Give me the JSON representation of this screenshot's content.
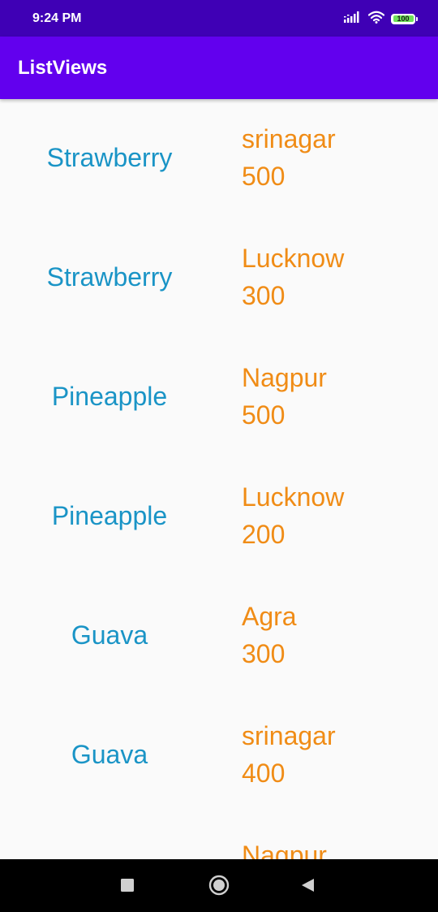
{
  "status_bar": {
    "time": "9:24 PM",
    "battery_level": "100",
    "icons": [
      "signal-icon",
      "wifi-icon",
      "battery-icon"
    ]
  },
  "app_bar": {
    "title": "ListViews",
    "color": "#6200ee"
  },
  "list": {
    "name_color": "#1a94c6",
    "detail_color": "#f08c16",
    "items": [
      {
        "name": "Strawberry",
        "city": "srinagar",
        "price": "500"
      },
      {
        "name": "Strawberry",
        "city": "Lucknow",
        "price": "300"
      },
      {
        "name": "Pineapple",
        "city": "Nagpur",
        "price": "500"
      },
      {
        "name": "Pineapple",
        "city": "Lucknow",
        "price": "200"
      },
      {
        "name": "Guava",
        "city": "Agra",
        "price": "300"
      },
      {
        "name": "Guava",
        "city": "srinagar",
        "price": "400"
      },
      {
        "name": "",
        "city": "Nagpur",
        "price": ""
      }
    ]
  },
  "nav_bar": {
    "buttons": [
      "recents-icon",
      "home-icon",
      "back-icon"
    ]
  }
}
